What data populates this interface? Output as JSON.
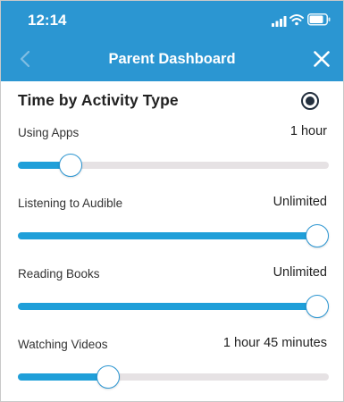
{
  "status_bar": {
    "time": "12:14"
  },
  "nav": {
    "title": "Parent Dashboard"
  },
  "section": {
    "title": "Time by Activity Type"
  },
  "icons": {
    "back": "chevron-left-icon",
    "close": "close-icon",
    "signal": "cellular-signal-icon",
    "wifi": "wifi-icon",
    "battery": "battery-icon"
  },
  "colors": {
    "header": "#2b96d2",
    "slider_fill": "#1f9fd9",
    "slider_track": "#e6e2e4",
    "radio": "#232f3e"
  },
  "activities": [
    {
      "label": "Using Apps",
      "value": "1 hour",
      "level": 0.17
    },
    {
      "label": "Listening to Audible",
      "value": "Unlimited",
      "level": 1.0
    },
    {
      "label": "Reading Books",
      "value": "Unlimited",
      "level": 1.0
    },
    {
      "label": "Watching Videos",
      "value": "1 hour 45 minutes",
      "level": 0.29
    }
  ]
}
